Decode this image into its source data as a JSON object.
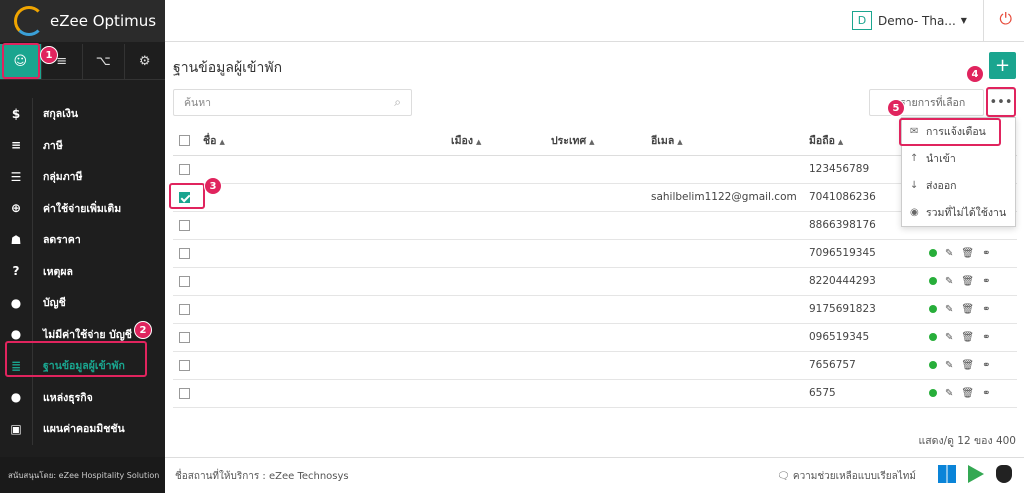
{
  "app": {
    "title": "eZee Optimus"
  },
  "header": {
    "property_initial": "D",
    "property_name": "Demo- Tha...",
    "power_icon": "power-icon"
  },
  "sidebar": {
    "top_tabs": [
      {
        "icon": "user-icon",
        "glyph": "☺"
      },
      {
        "icon": "list-icon",
        "glyph": "≡"
      },
      {
        "icon": "cart-icon",
        "glyph": "⌥"
      },
      {
        "icon": "gear-icon",
        "glyph": "⚙"
      }
    ],
    "items": [
      {
        "label": "สกุลเงิน",
        "icon": "dollar-icon",
        "glyph": "$"
      },
      {
        "label": "ภาษี",
        "icon": "menu-icon",
        "glyph": "≡"
      },
      {
        "label": "กลุ่มภาษี",
        "icon": "list-icon",
        "glyph": "☰"
      },
      {
        "label": "ค่าใช้จ่ายเพิ่มเติม",
        "icon": "plus-circle-icon",
        "glyph": "⊕"
      },
      {
        "label": "ลดราคา",
        "icon": "gift-icon",
        "glyph": "☗"
      },
      {
        "label": "เหตุผล",
        "icon": "question-icon",
        "glyph": "?"
      },
      {
        "label": "บัญชี",
        "icon": "user-icon",
        "glyph": "●"
      },
      {
        "label": "ไม่มีค่าใช้จ่าย บัญชี",
        "icon": "user-icon",
        "glyph": "●"
      },
      {
        "label": "ฐานข้อมูลผู้เข้าพัก",
        "icon": "database-icon",
        "glyph": "≣"
      },
      {
        "label": "แหล่งธุรกิจ",
        "icon": "group-icon",
        "glyph": "●"
      },
      {
        "label": "แผนค่าคอมมิชชัน",
        "icon": "money-icon",
        "glyph": "▣"
      }
    ],
    "footer": "สนับสนุนโดย: eZee Hospitality Solution"
  },
  "main": {
    "title": "ฐานข้อมูลผู้เข้าพัก",
    "add_label": "+",
    "search_placeholder": "ค้นหา",
    "selected_action": "รายการที่เลือก",
    "more_label": "•••",
    "columns": [
      "ชื่อ",
      "เมือง",
      "ประเทศ",
      "อีเมล",
      "มือถือ"
    ],
    "rows": [
      {
        "email": "",
        "mobile": "123456789",
        "checked": false
      },
      {
        "email": "sahilbelim1122@gmail.com",
        "mobile": "7041086236",
        "checked": true
      },
      {
        "email": "",
        "mobile": "8866398176",
        "checked": false
      },
      {
        "email": "",
        "mobile": "7096519345",
        "checked": false
      },
      {
        "email": "",
        "mobile": "8220444293",
        "checked": false
      },
      {
        "email": "",
        "mobile": "9175691823",
        "checked": false
      },
      {
        "email": "",
        "mobile": "096519345",
        "checked": false
      },
      {
        "email": "",
        "mobile": "7656757",
        "checked": false
      },
      {
        "email": "",
        "mobile": "6575",
        "checked": false
      }
    ],
    "dropdown": [
      {
        "label": "การแจ้งเตือน",
        "icon": "mail-icon",
        "glyph": "✉"
      },
      {
        "label": "นำเข้า",
        "icon": "upload-icon",
        "glyph": "↑"
      },
      {
        "label": "ส่งออก",
        "icon": "download-icon",
        "glyph": "↓"
      },
      {
        "label": "รวมที่ไม่ได้ใช้งาน",
        "icon": "eye-icon",
        "glyph": "◉"
      }
    ],
    "pager": "แสดง/ดู 12 ของ 400"
  },
  "footer": {
    "provider": "ชื่อสถานที่ให้บริการ : eZee Technosys",
    "help": "ความช่วยเหลือแบบเรียลไทม์"
  },
  "annotations": [
    "1",
    "2",
    "3",
    "4",
    "5"
  ],
  "colors": {
    "accent": "#1aa58f",
    "highlight": "#e0245e",
    "sidebar": "#1e1e1e"
  }
}
